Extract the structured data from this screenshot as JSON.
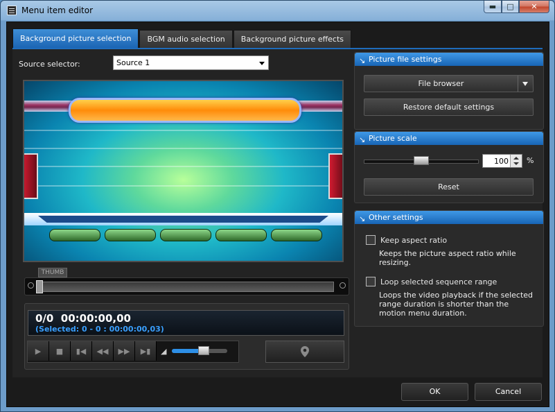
{
  "window": {
    "title": "Menu item editor",
    "min_icon": "minimize-icon",
    "max_icon": "maximize-icon",
    "close_icon": "close-icon"
  },
  "tabs": [
    {
      "label": "Background picture selection",
      "active": true
    },
    {
      "label": "BGM audio selection",
      "active": false
    },
    {
      "label": "Background picture effects",
      "active": false
    }
  ],
  "source": {
    "label": "Source selector:",
    "value": "Source 1"
  },
  "timeline": {
    "thumb_label": "THUMB"
  },
  "player": {
    "time": "0/0  00:00:00,00",
    "selected": "(Selected: 0 - 0 : 00:00:00,03)",
    "controls": [
      "play-icon",
      "stop-icon",
      "prev-frame-icon",
      "rewind-icon",
      "fast-forward-icon",
      "next-frame-icon"
    ],
    "volume_icon": "speaker-icon",
    "volume_level": 0.6,
    "marker_icon": "map-pin-icon"
  },
  "picture_file_settings": {
    "header": "Picture file settings",
    "file_browser": "File browser",
    "restore": "Restore default settings"
  },
  "picture_scale": {
    "header": "Picture scale",
    "value": "100",
    "unit": "%",
    "slider_level": 0.5,
    "reset": "Reset"
  },
  "other_settings": {
    "header": "Other settings",
    "keep_aspect": {
      "label": "Keep aspect ratio",
      "checked": false,
      "desc": "Keeps the picture aspect ratio while resizing."
    },
    "loop_range": {
      "label": "Loop selected sequence range",
      "checked": false,
      "desc": "Loops the video playback if the selected range duration is shorter than the motion menu duration."
    }
  },
  "footer": {
    "ok": "OK",
    "cancel": "Cancel"
  },
  "colors": {
    "accent": "#1b64b3",
    "header_blue": "#3f98e6",
    "lcd_selection": "#3aa0ff"
  }
}
